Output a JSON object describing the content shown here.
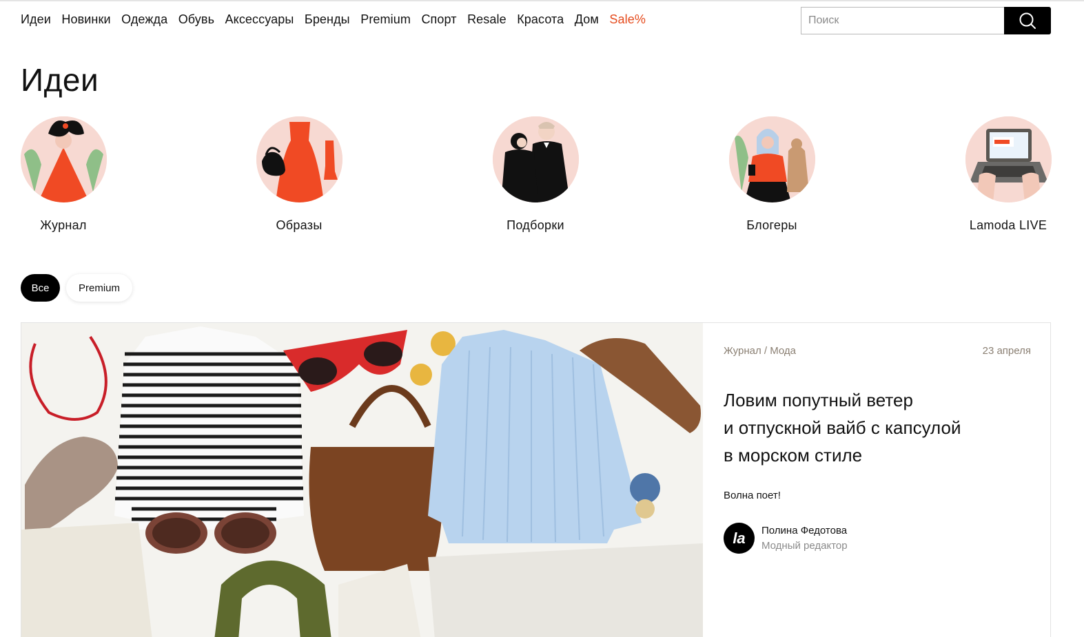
{
  "header": {
    "nav": [
      {
        "label": "Идеи"
      },
      {
        "label": "Новинки"
      },
      {
        "label": "Одежда"
      },
      {
        "label": "Обувь"
      },
      {
        "label": "Аксессуары"
      },
      {
        "label": "Бренды"
      },
      {
        "label": "Premium"
      },
      {
        "label": "Спорт"
      },
      {
        "label": "Resale"
      },
      {
        "label": "Красота"
      },
      {
        "label": "Дом"
      },
      {
        "label": "Sale%"
      }
    ],
    "search_placeholder": "Поиск",
    "sale_color": "#e54a1c"
  },
  "page": {
    "title": "Идеи"
  },
  "categories": [
    {
      "label": "Журнал",
      "icon": "woman-illustration-icon"
    },
    {
      "label": "Образы",
      "icon": "dress-illustration-icon"
    },
    {
      "label": "Подборки",
      "icon": "couple-illustration-icon"
    },
    {
      "label": "Блогеры",
      "icon": "blogger-illustration-icon"
    },
    {
      "label": "Lamoda LIVE",
      "icon": "laptop-illustration-icon"
    }
  ],
  "filters": [
    {
      "label": "Все",
      "active": true
    },
    {
      "label": "Premium",
      "active": false
    }
  ],
  "article": {
    "section": "Журнал",
    "separator": "/",
    "subsection": "Мода",
    "date": "23 апреля",
    "title_lines": [
      "Ловим попутный ветер",
      "и отпускной вайб с капсулой",
      "в морском стиле"
    ],
    "lead": "Волна поет!",
    "author": {
      "avatar_text": "la",
      "name": "Полина Федотова",
      "role": "Модный редактор"
    }
  }
}
